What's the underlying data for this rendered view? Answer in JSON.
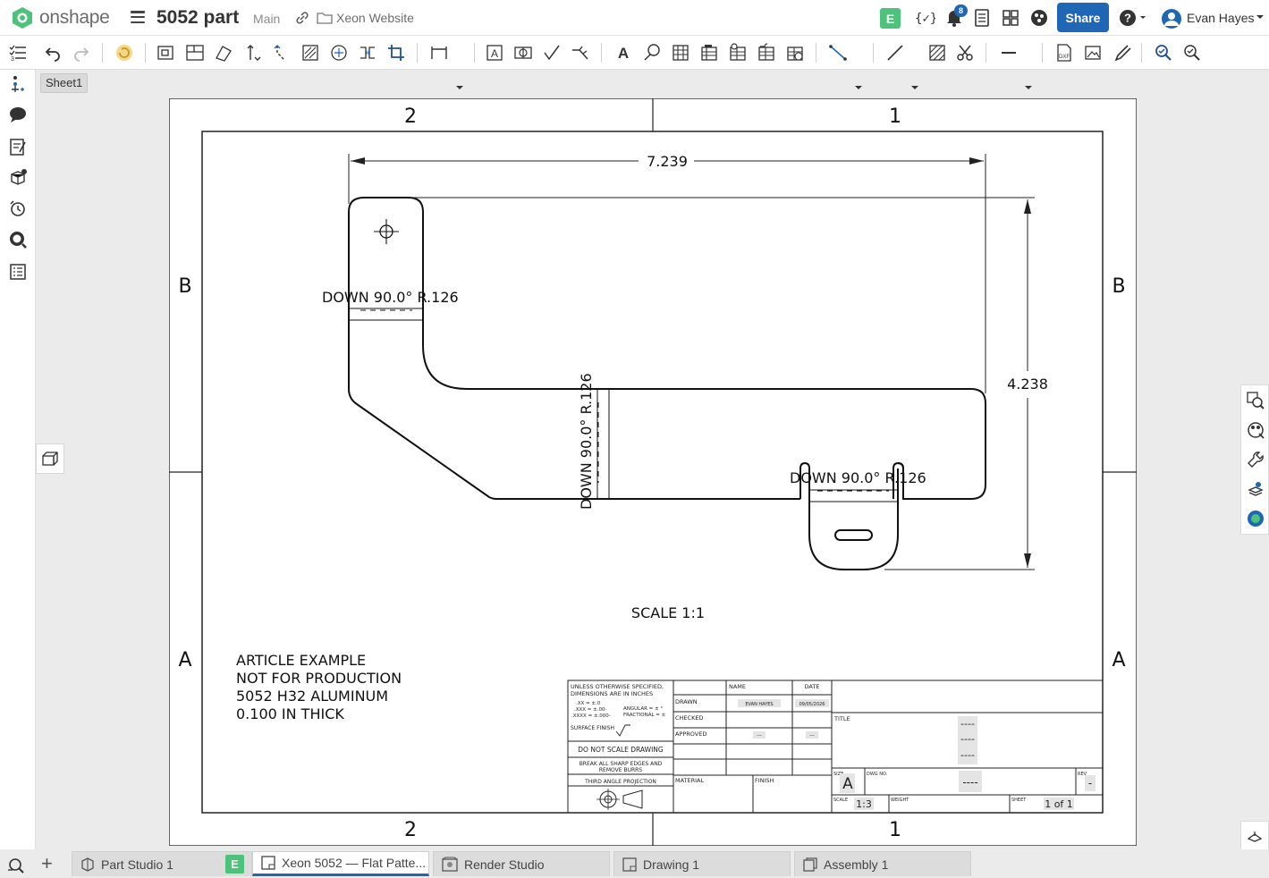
{
  "app": {
    "brand": "onshape",
    "document_name": "5052 part",
    "branch": "Main",
    "folder": "Xeon Website",
    "edit_badge": "E",
    "notifications_count": "8",
    "share_label": "Share",
    "user_name": "Evan Hayes",
    "accent_color": "#1f66b5",
    "brand_green": "#4dc27a"
  },
  "sheet_tab": "Sheet1",
  "drawing": {
    "zone_top_left": "2",
    "zone_top_right": "1",
    "zone_bottom_left": "2",
    "zone_bottom_right": "1",
    "row_upper_left": "B",
    "row_upper_right": "B",
    "row_lower_left": "A",
    "row_lower_right": "A",
    "dim_width": "7.239",
    "dim_height": "4.238",
    "bend_note_1": "DOWN 90.0° R.126",
    "bend_note_2": "DOWN 90.0° R.126",
    "bend_note_3": "DOWN 90.0° R.126",
    "scale_label": "SCALE 1:1",
    "notes": [
      "ARTICLE EXAMPLE",
      "NOT FOR PRODUCTION",
      "5052 H32 ALUMINUM",
      "0.100 IN THICK"
    ]
  },
  "title_block": {
    "tolerance_l1": "UNLESS OTHERWISE SPECIFIED,",
    "tolerance_l2": "DIMENSIONS ARE IN INCHES",
    "tol_xx": ".XX = ±.0",
    "tol_xxx": ".XXX = ±.00-",
    "tol_xxxx": ".XXXX = ±.000-",
    "tol_angular": "ANGULAR = ± °",
    "tol_fractional": "FRACTIONAL = ±",
    "surface_finish": "SURFACE FINISH",
    "do_not_scale": "DO NOT SCALE DRAWING",
    "break_edges_1": "BREAK ALL SHARP EDGES AND",
    "break_edges_2": "REMOVE BURRS",
    "projection": "THIRD ANGLE PROJECTION",
    "col_name": "NAME",
    "col_date": "DATE",
    "row_drawn": "DRAWN",
    "row_checked": "CHECKED",
    "row_approved": "APPROVED",
    "drawn_name": "EVAN HAYES",
    "drawn_date": "09/05/2026",
    "approved_name": "---",
    "approved_date": "---",
    "material_label": "MATERIAL",
    "finish_label": "FINISH",
    "title_label": "TITLE",
    "title_l1": "----",
    "title_l2": "----",
    "title_l3": "----",
    "size_label": "SIZE",
    "size_value": "A",
    "dwg_no_label": "DWG NO.",
    "dwg_no_value": "----",
    "rev_label": "REV",
    "rev_value": "-",
    "scale_label": "SCALE",
    "scale_value": "1:3",
    "weight_label": "WEIGHT",
    "sheet_label": "SHEET",
    "sheet_value": "1 of 1"
  },
  "bottom_tabs": [
    {
      "label": "Part Studio 1",
      "icon": "part-studio-icon",
      "active": false
    },
    {
      "label": "Xeon 5052 — Flat Patte...",
      "icon": "drawing-icon",
      "active": true
    },
    {
      "label": "Render Studio",
      "icon": "render-studio-icon",
      "active": false
    },
    {
      "label": "Drawing 1",
      "icon": "drawing-icon",
      "active": false
    },
    {
      "label": "Assembly 1",
      "icon": "assembly-icon",
      "active": false
    }
  ],
  "bottom_tab_edit_badge": "E"
}
